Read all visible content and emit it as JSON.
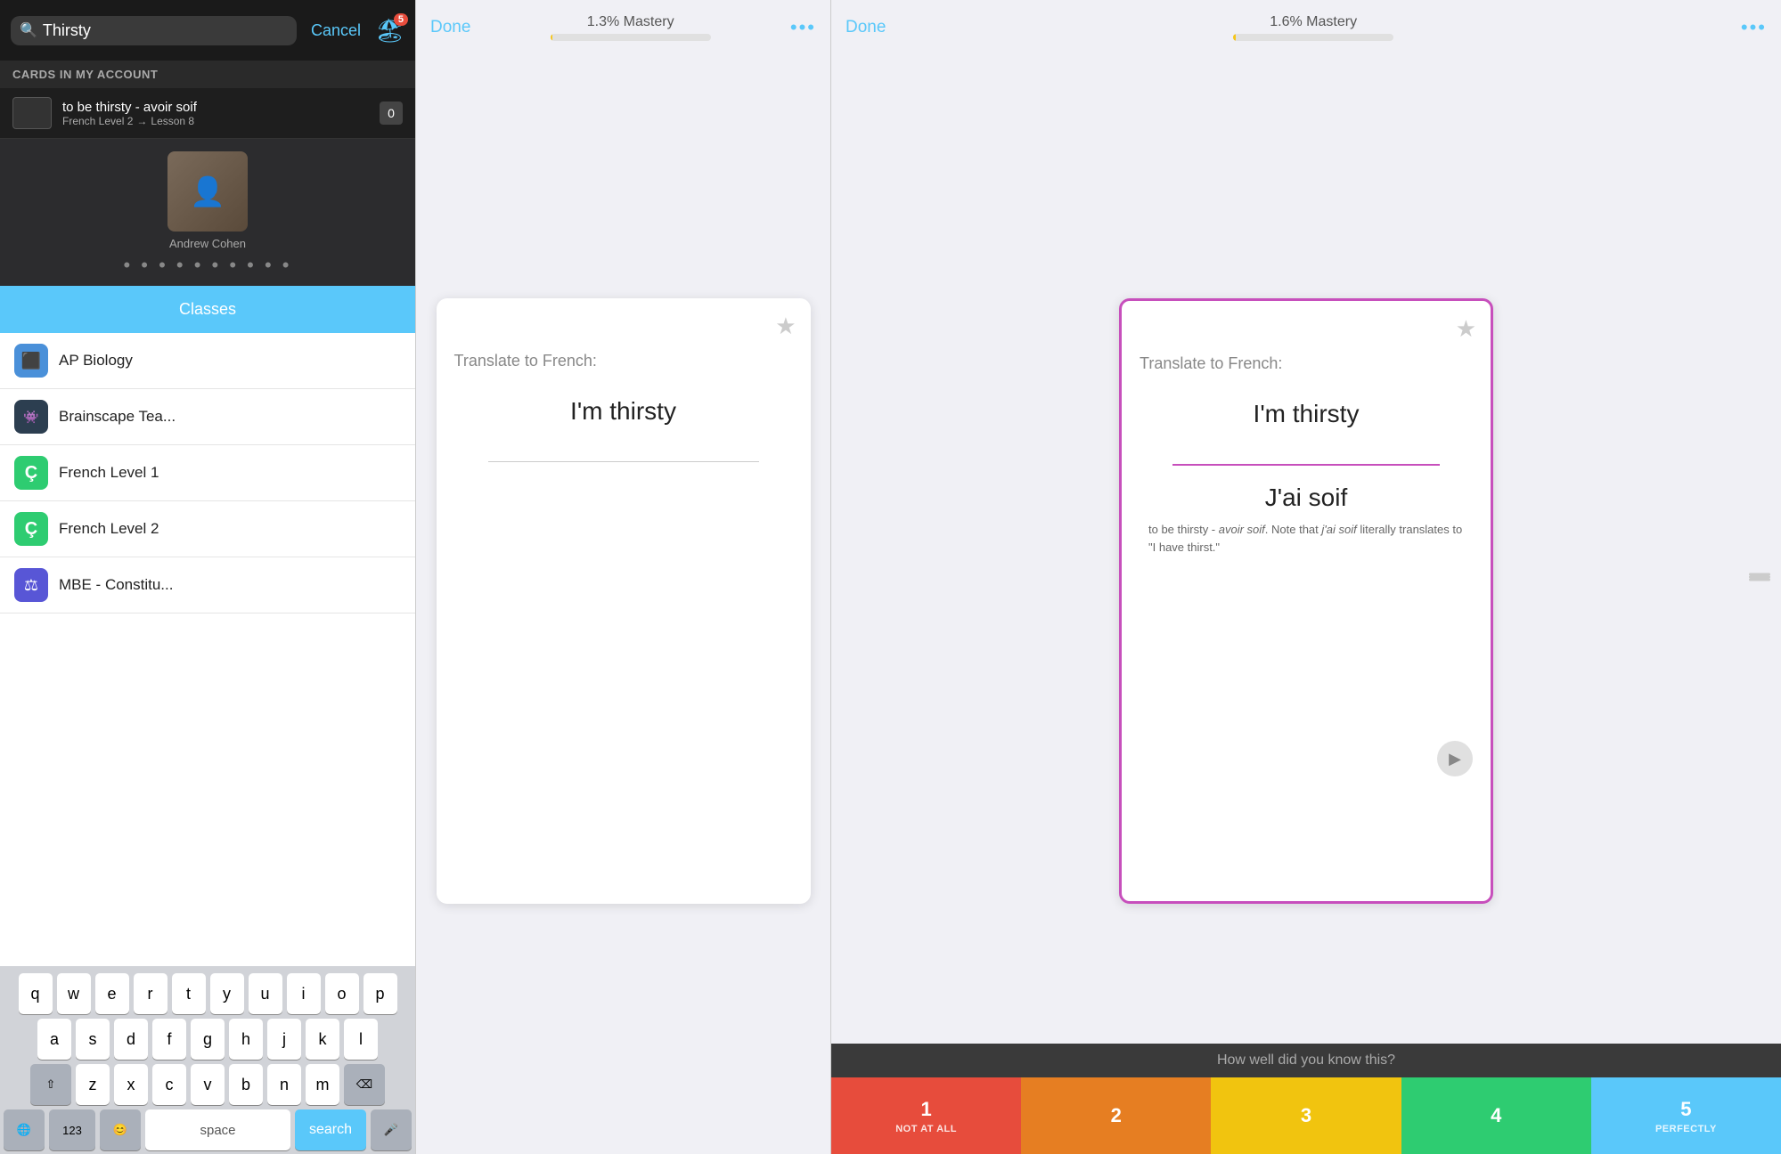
{
  "panel1": {
    "search_placeholder": "Thirsty",
    "search_value": "Thirsty",
    "cancel_label": "Cancel",
    "notification_count": "5",
    "cards_section_label": "CARDS IN MY ACCOUNT",
    "card_result": {
      "title": "to be thirsty - avoir soif",
      "subtitle": "French Level 2",
      "arrow": "→",
      "lesson": "Lesson 8",
      "count": "0"
    },
    "profile": {
      "name": "Andrew Cohen",
      "dots": "• • • • • • • • • •"
    },
    "classes_label": "Classes",
    "class_items": [
      {
        "name": "AP Biology",
        "color": "#4a90d9",
        "icon": "⬛"
      },
      {
        "name": "Brainscape Tea...",
        "color": "#2c3e50",
        "icon": "👾"
      },
      {
        "name": "French Level 1",
        "color": "#2ecc71",
        "icon": "Ç"
      },
      {
        "name": "French Level 2",
        "color": "#2ecc71",
        "icon": "Ç"
      },
      {
        "name": "MBE - Constitu...",
        "color": "#5856d6",
        "icon": "⚖"
      }
    ],
    "keyboard": {
      "rows": [
        [
          "q",
          "w",
          "e",
          "r",
          "t",
          "y",
          "u",
          "i",
          "o",
          "p"
        ],
        [
          "a",
          "s",
          "d",
          "f",
          "g",
          "h",
          "j",
          "k",
          "l"
        ],
        [
          "⇧",
          "z",
          "x",
          "c",
          "v",
          "b",
          "n",
          "m",
          "⌫"
        ]
      ],
      "bottom": {
        "num": "123",
        "emoji": "😊",
        "space": "space",
        "search": "search",
        "mic": "🎤",
        "globe": "🌐"
      }
    }
  },
  "panel2": {
    "done_label": "Done",
    "mastery_label": "1.3% Mastery",
    "mastery_pct": 1.3,
    "more_icon": "•••",
    "card": {
      "prompt": "Translate to French:",
      "question": "I'm thirsty"
    }
  },
  "panel3": {
    "done_label": "Done",
    "mastery_label": "1.6% Mastery",
    "mastery_pct": 1.6,
    "more_icon": "•••",
    "card": {
      "prompt": "Translate to French:",
      "question": "I'm thirsty",
      "answer": "J'ai soif",
      "note": "to be thirsty - avoir soif. Note that j'ai soif literally translates to \"I have thirst.\""
    },
    "how_well_label": "How well did you know this?",
    "ratings": [
      {
        "num": "1",
        "label": "NOT AT ALL",
        "color": "#e74c3c"
      },
      {
        "num": "2",
        "label": "",
        "color": "#e67e22"
      },
      {
        "num": "3",
        "label": "",
        "color": "#f1c40f"
      },
      {
        "num": "4",
        "label": "",
        "color": "#2ecc71"
      },
      {
        "num": "5",
        "label": "PERFECTLY",
        "color": "#5ac8fa"
      }
    ]
  }
}
